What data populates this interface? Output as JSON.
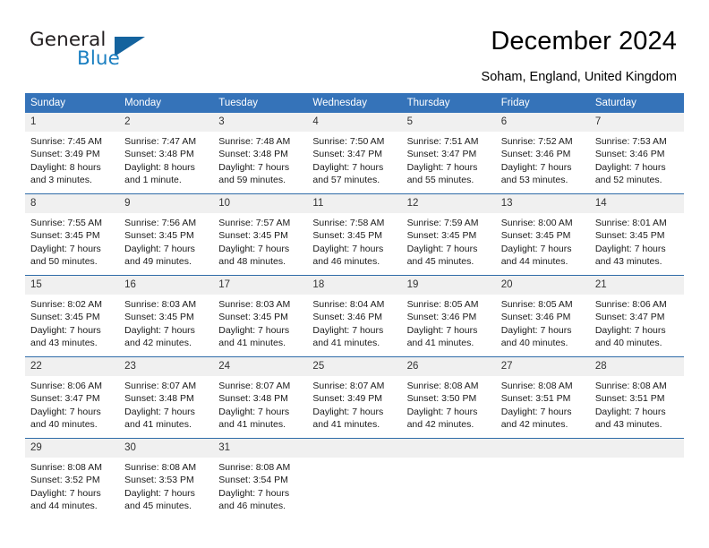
{
  "brand": {
    "name_part1": "General",
    "name_part2": "Blue",
    "triangle_icon": "triangle-icon",
    "color_dark": "#231f20",
    "color_blue": "#1a7fc1",
    "color_triangle": "#14639e"
  },
  "header": {
    "title": "December 2024",
    "subtitle": "Soham, England, United Kingdom"
  },
  "theme": {
    "header_row_bg": "#3573b9",
    "daynum_bg": "#f0f0f0",
    "row_divider": "#2f6ca8"
  },
  "weekdays": [
    "Sunday",
    "Monday",
    "Tuesday",
    "Wednesday",
    "Thursday",
    "Friday",
    "Saturday"
  ],
  "weeks": [
    [
      {
        "day": "1",
        "sunrise": "Sunrise: 7:45 AM",
        "sunset": "Sunset: 3:49 PM",
        "daylight1": "Daylight: 8 hours",
        "daylight2": "and 3 minutes."
      },
      {
        "day": "2",
        "sunrise": "Sunrise: 7:47 AM",
        "sunset": "Sunset: 3:48 PM",
        "daylight1": "Daylight: 8 hours",
        "daylight2": "and 1 minute."
      },
      {
        "day": "3",
        "sunrise": "Sunrise: 7:48 AM",
        "sunset": "Sunset: 3:48 PM",
        "daylight1": "Daylight: 7 hours",
        "daylight2": "and 59 minutes."
      },
      {
        "day": "4",
        "sunrise": "Sunrise: 7:50 AM",
        "sunset": "Sunset: 3:47 PM",
        "daylight1": "Daylight: 7 hours",
        "daylight2": "and 57 minutes."
      },
      {
        "day": "5",
        "sunrise": "Sunrise: 7:51 AM",
        "sunset": "Sunset: 3:47 PM",
        "daylight1": "Daylight: 7 hours",
        "daylight2": "and 55 minutes."
      },
      {
        "day": "6",
        "sunrise": "Sunrise: 7:52 AM",
        "sunset": "Sunset: 3:46 PM",
        "daylight1": "Daylight: 7 hours",
        "daylight2": "and 53 minutes."
      },
      {
        "day": "7",
        "sunrise": "Sunrise: 7:53 AM",
        "sunset": "Sunset: 3:46 PM",
        "daylight1": "Daylight: 7 hours",
        "daylight2": "and 52 minutes."
      }
    ],
    [
      {
        "day": "8",
        "sunrise": "Sunrise: 7:55 AM",
        "sunset": "Sunset: 3:45 PM",
        "daylight1": "Daylight: 7 hours",
        "daylight2": "and 50 minutes."
      },
      {
        "day": "9",
        "sunrise": "Sunrise: 7:56 AM",
        "sunset": "Sunset: 3:45 PM",
        "daylight1": "Daylight: 7 hours",
        "daylight2": "and 49 minutes."
      },
      {
        "day": "10",
        "sunrise": "Sunrise: 7:57 AM",
        "sunset": "Sunset: 3:45 PM",
        "daylight1": "Daylight: 7 hours",
        "daylight2": "and 48 minutes."
      },
      {
        "day": "11",
        "sunrise": "Sunrise: 7:58 AM",
        "sunset": "Sunset: 3:45 PM",
        "daylight1": "Daylight: 7 hours",
        "daylight2": "and 46 minutes."
      },
      {
        "day": "12",
        "sunrise": "Sunrise: 7:59 AM",
        "sunset": "Sunset: 3:45 PM",
        "daylight1": "Daylight: 7 hours",
        "daylight2": "and 45 minutes."
      },
      {
        "day": "13",
        "sunrise": "Sunrise: 8:00 AM",
        "sunset": "Sunset: 3:45 PM",
        "daylight1": "Daylight: 7 hours",
        "daylight2": "and 44 minutes."
      },
      {
        "day": "14",
        "sunrise": "Sunrise: 8:01 AM",
        "sunset": "Sunset: 3:45 PM",
        "daylight1": "Daylight: 7 hours",
        "daylight2": "and 43 minutes."
      }
    ],
    [
      {
        "day": "15",
        "sunrise": "Sunrise: 8:02 AM",
        "sunset": "Sunset: 3:45 PM",
        "daylight1": "Daylight: 7 hours",
        "daylight2": "and 43 minutes."
      },
      {
        "day": "16",
        "sunrise": "Sunrise: 8:03 AM",
        "sunset": "Sunset: 3:45 PM",
        "daylight1": "Daylight: 7 hours",
        "daylight2": "and 42 minutes."
      },
      {
        "day": "17",
        "sunrise": "Sunrise: 8:03 AM",
        "sunset": "Sunset: 3:45 PM",
        "daylight1": "Daylight: 7 hours",
        "daylight2": "and 41 minutes."
      },
      {
        "day": "18",
        "sunrise": "Sunrise: 8:04 AM",
        "sunset": "Sunset: 3:46 PM",
        "daylight1": "Daylight: 7 hours",
        "daylight2": "and 41 minutes."
      },
      {
        "day": "19",
        "sunrise": "Sunrise: 8:05 AM",
        "sunset": "Sunset: 3:46 PM",
        "daylight1": "Daylight: 7 hours",
        "daylight2": "and 41 minutes."
      },
      {
        "day": "20",
        "sunrise": "Sunrise: 8:05 AM",
        "sunset": "Sunset: 3:46 PM",
        "daylight1": "Daylight: 7 hours",
        "daylight2": "and 40 minutes."
      },
      {
        "day": "21",
        "sunrise": "Sunrise: 8:06 AM",
        "sunset": "Sunset: 3:47 PM",
        "daylight1": "Daylight: 7 hours",
        "daylight2": "and 40 minutes."
      }
    ],
    [
      {
        "day": "22",
        "sunrise": "Sunrise: 8:06 AM",
        "sunset": "Sunset: 3:47 PM",
        "daylight1": "Daylight: 7 hours",
        "daylight2": "and 40 minutes."
      },
      {
        "day": "23",
        "sunrise": "Sunrise: 8:07 AM",
        "sunset": "Sunset: 3:48 PM",
        "daylight1": "Daylight: 7 hours",
        "daylight2": "and 41 minutes."
      },
      {
        "day": "24",
        "sunrise": "Sunrise: 8:07 AM",
        "sunset": "Sunset: 3:48 PM",
        "daylight1": "Daylight: 7 hours",
        "daylight2": "and 41 minutes."
      },
      {
        "day": "25",
        "sunrise": "Sunrise: 8:07 AM",
        "sunset": "Sunset: 3:49 PM",
        "daylight1": "Daylight: 7 hours",
        "daylight2": "and 41 minutes."
      },
      {
        "day": "26",
        "sunrise": "Sunrise: 8:08 AM",
        "sunset": "Sunset: 3:50 PM",
        "daylight1": "Daylight: 7 hours",
        "daylight2": "and 42 minutes."
      },
      {
        "day": "27",
        "sunrise": "Sunrise: 8:08 AM",
        "sunset": "Sunset: 3:51 PM",
        "daylight1": "Daylight: 7 hours",
        "daylight2": "and 42 minutes."
      },
      {
        "day": "28",
        "sunrise": "Sunrise: 8:08 AM",
        "sunset": "Sunset: 3:51 PM",
        "daylight1": "Daylight: 7 hours",
        "daylight2": "and 43 minutes."
      }
    ],
    [
      {
        "day": "29",
        "sunrise": "Sunrise: 8:08 AM",
        "sunset": "Sunset: 3:52 PM",
        "daylight1": "Daylight: 7 hours",
        "daylight2": "and 44 minutes."
      },
      {
        "day": "30",
        "sunrise": "Sunrise: 8:08 AM",
        "sunset": "Sunset: 3:53 PM",
        "daylight1": "Daylight: 7 hours",
        "daylight2": "and 45 minutes."
      },
      {
        "day": "31",
        "sunrise": "Sunrise: 8:08 AM",
        "sunset": "Sunset: 3:54 PM",
        "daylight1": "Daylight: 7 hours",
        "daylight2": "and 46 minutes."
      },
      {
        "day": "",
        "sunrise": "",
        "sunset": "",
        "daylight1": "",
        "daylight2": ""
      },
      {
        "day": "",
        "sunrise": "",
        "sunset": "",
        "daylight1": "",
        "daylight2": ""
      },
      {
        "day": "",
        "sunrise": "",
        "sunset": "",
        "daylight1": "",
        "daylight2": ""
      },
      {
        "day": "",
        "sunrise": "",
        "sunset": "",
        "daylight1": "",
        "daylight2": ""
      }
    ]
  ]
}
